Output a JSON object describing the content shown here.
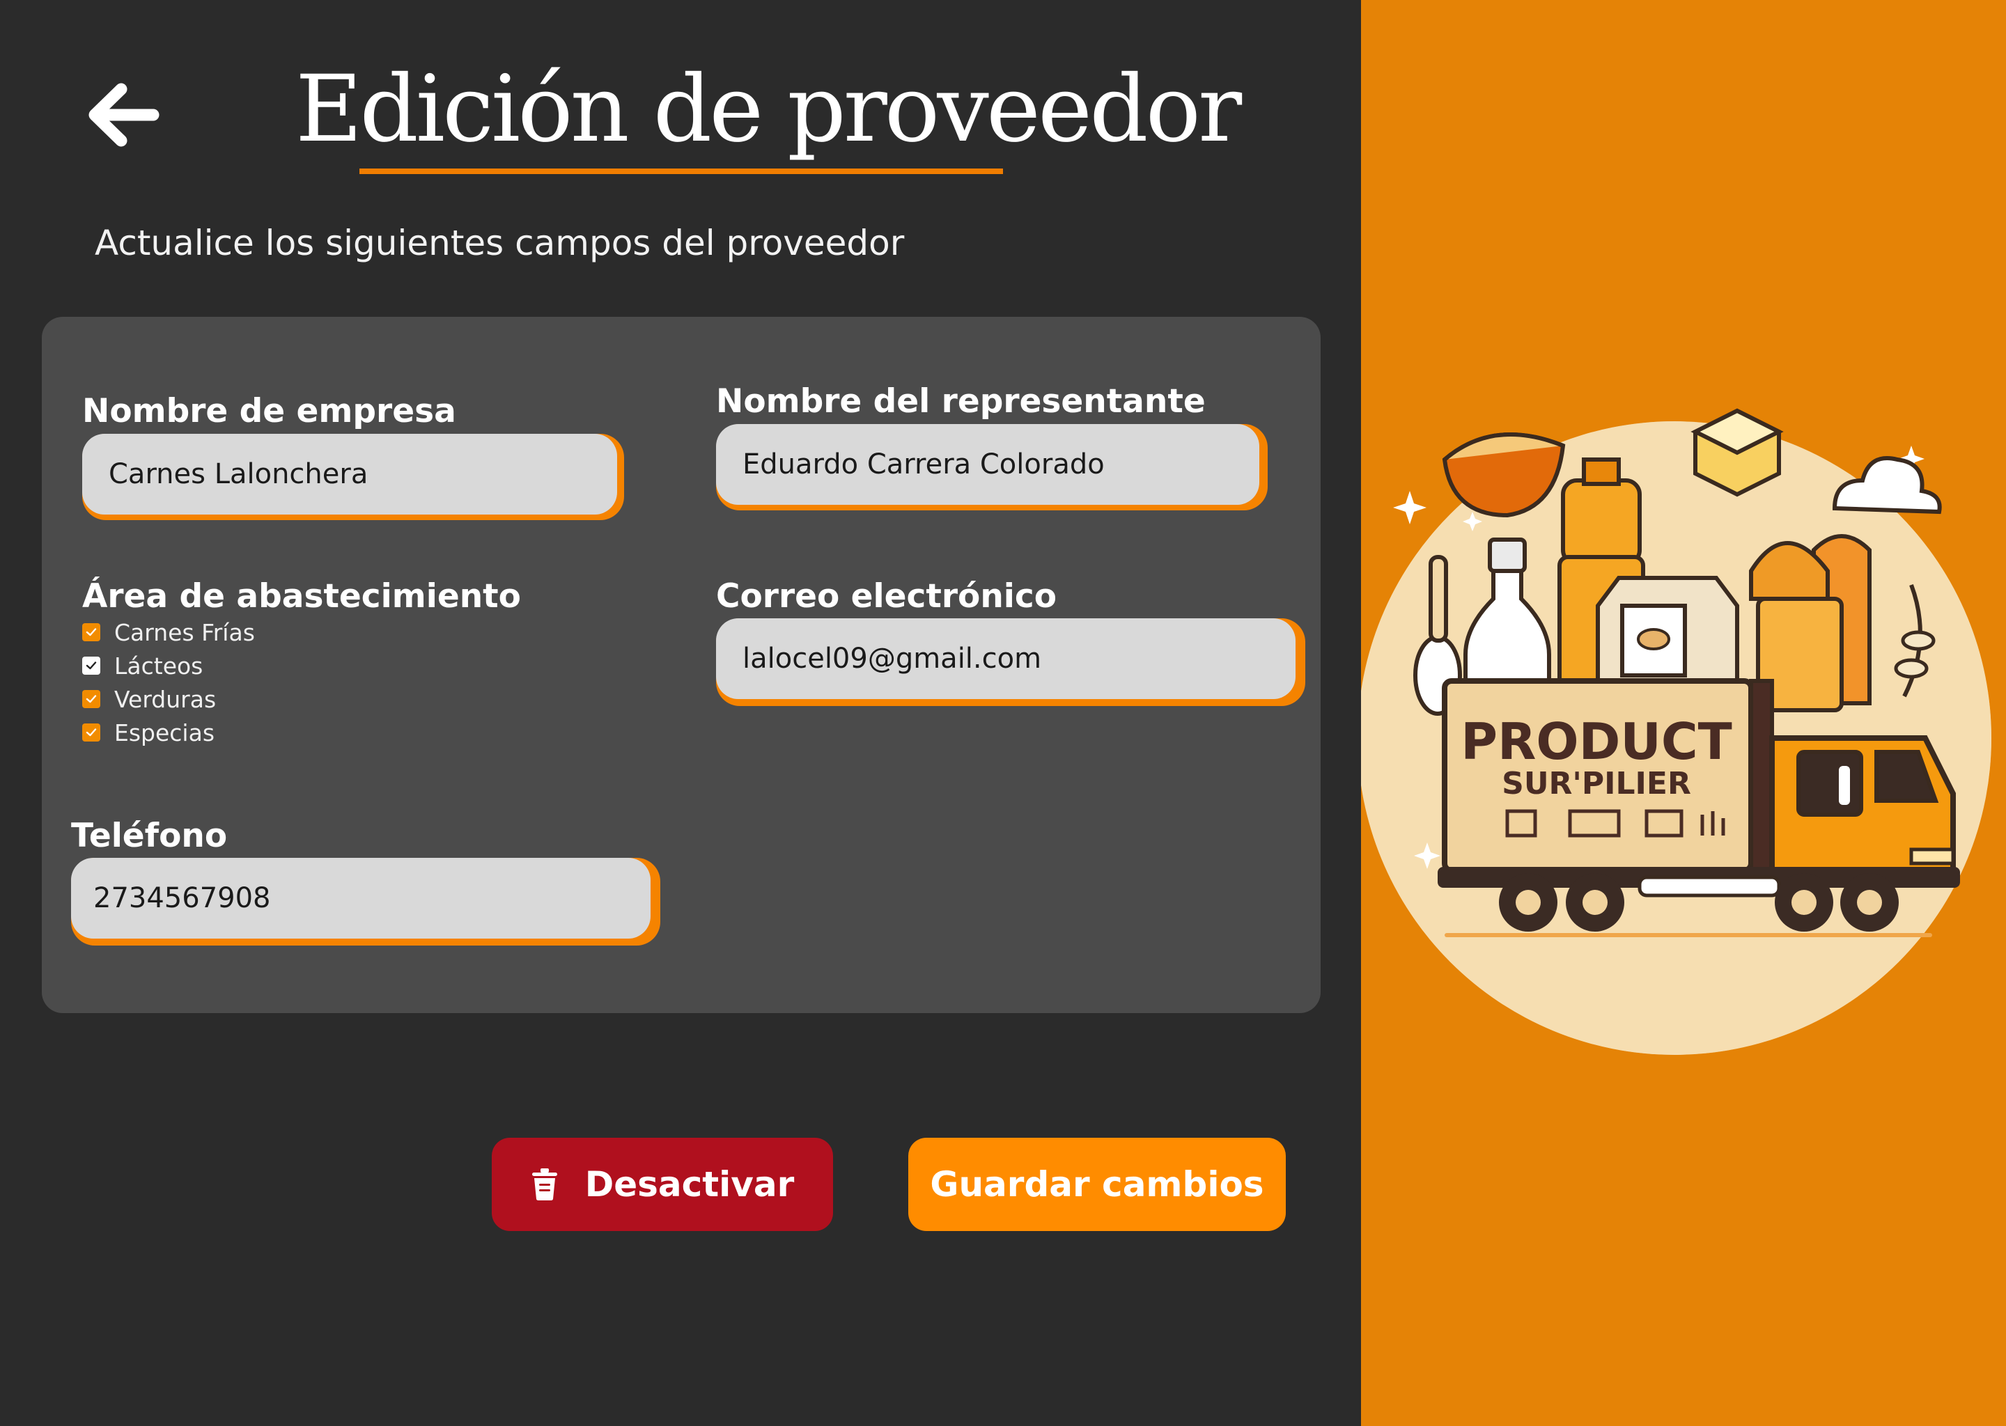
{
  "header": {
    "title": "Edición de proveedor",
    "subtitle": "Actualice los siguientes campos del proveedor",
    "back_icon": "arrow-left-icon"
  },
  "form": {
    "company_name": {
      "label": "Nombre de empresa",
      "value": "Carnes Lalonchera"
    },
    "representative_name": {
      "label": "Nombre del representante",
      "value": "Eduardo Carrera Colorado"
    },
    "supply_area": {
      "label": "Área de abastecimiento",
      "options": [
        {
          "label": "Carnes Frías",
          "checked": true,
          "box_color": "#f28c00"
        },
        {
          "label": "Lácteos",
          "checked": true,
          "box_color": "#ffffff"
        },
        {
          "label": "Verduras",
          "checked": true,
          "box_color": "#f28c00"
        },
        {
          "label": "Especias",
          "checked": true,
          "box_color": "#f28c00"
        }
      ]
    },
    "email": {
      "label": "Correo electrónico",
      "value": "lalocel09@gmail.com"
    },
    "phone": {
      "label": "Teléfono",
      "value": "2734567908"
    }
  },
  "actions": {
    "deactivate_label": "Desactivar",
    "deactivate_icon": "trash-icon",
    "save_label": "Guardar cambios"
  },
  "illustration": {
    "truck_text_line1": "PRODUCT",
    "truck_text_line2": "SUR'PILIER"
  },
  "colors": {
    "background": "#2b2b2b",
    "card": "#4b4b4b",
    "accent": "#f58300",
    "side_panel": "#e58306",
    "danger": "#b0101e",
    "input_bg": "#d9d9d9"
  }
}
